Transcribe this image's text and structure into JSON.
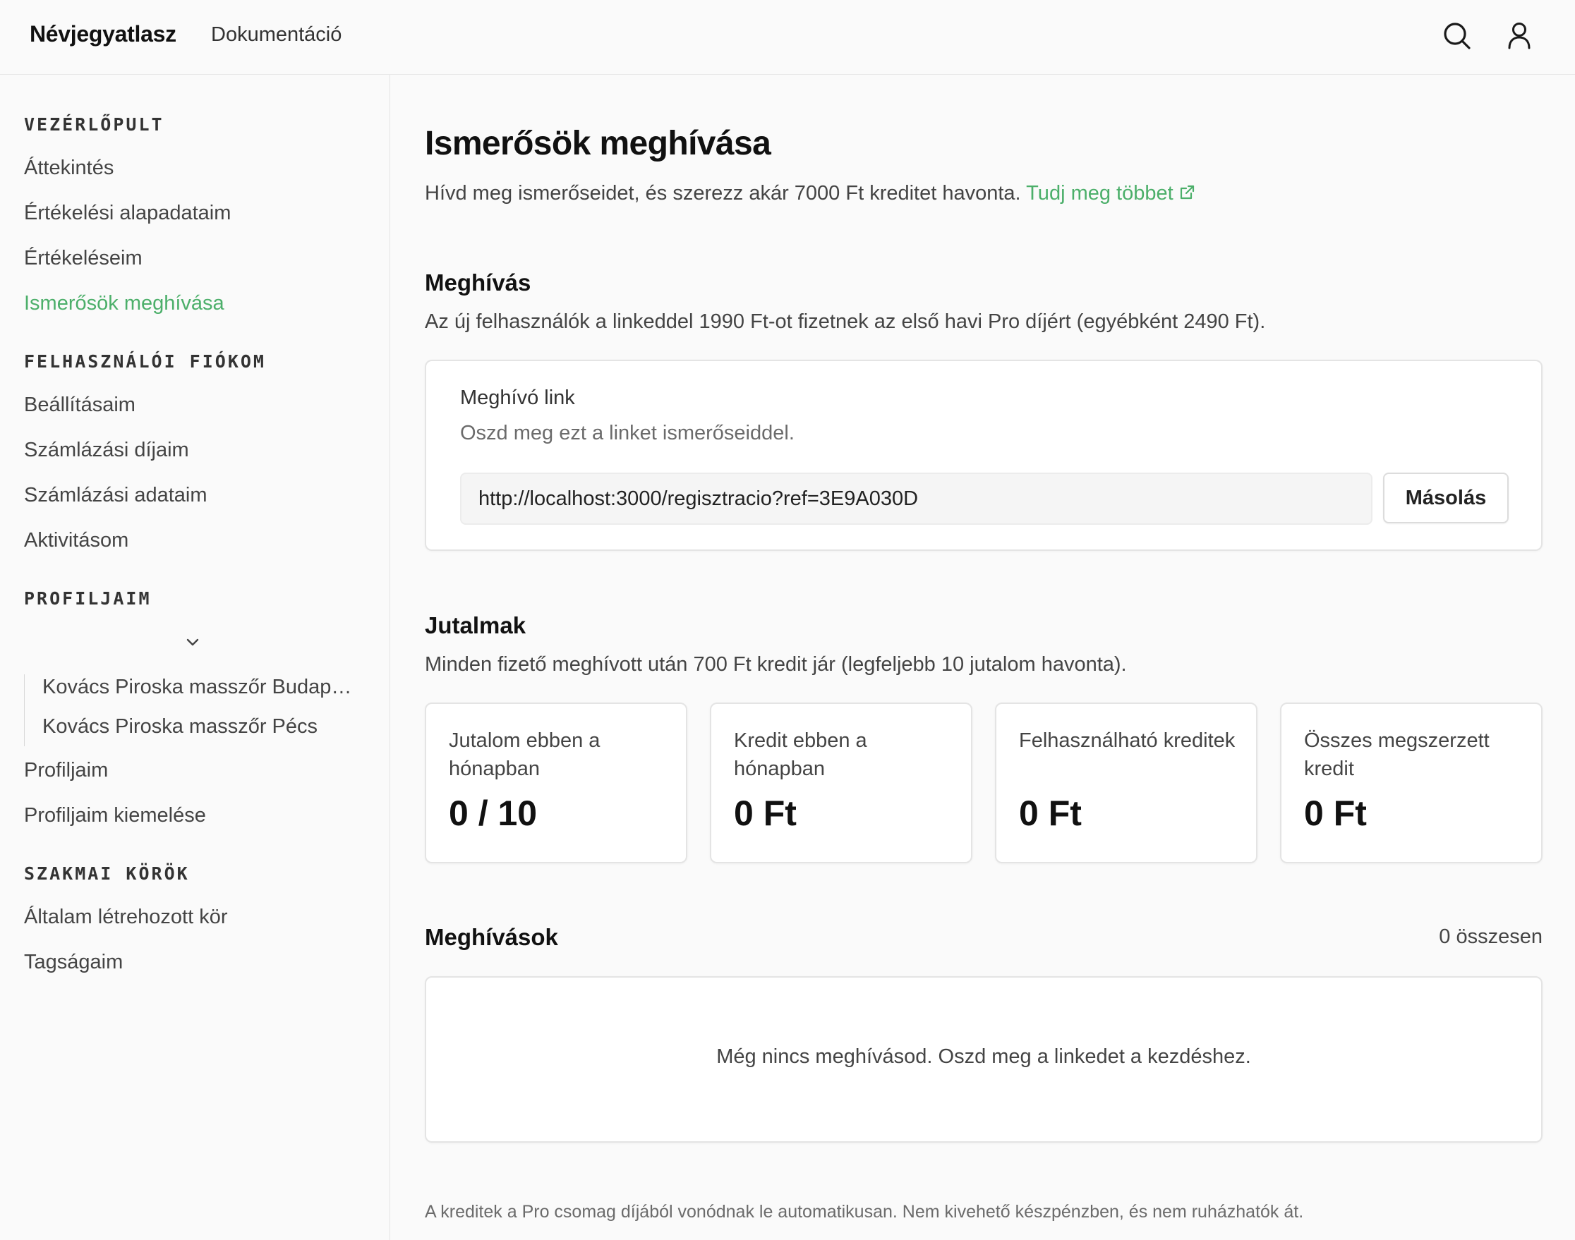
{
  "header": {
    "brand": "Névjegyatlasz",
    "doc_link": "Dokumentáció"
  },
  "sidebar": {
    "sections": [
      {
        "heading": "VEZÉRLŐPULT",
        "items": [
          "Áttekintés",
          "Értékelési alapadataim",
          "Értékeléseim",
          "Ismerősök meghívása"
        ]
      },
      {
        "heading": "FELHASZNÁLÓI FIÓKOM",
        "items": [
          "Beállításaim",
          "Számlázási díjaim",
          "Számlázási adataim",
          "Aktivitásom"
        ]
      },
      {
        "heading": "PROFILJAIM",
        "profiles": [
          "Kovács Piroska masszőr Budapest",
          "Kovács Piroska masszőr Pécs"
        ],
        "items": [
          "Profiljaim",
          "Profiljaim kiemelése"
        ]
      },
      {
        "heading": "SZAKMAI KÖRÖK",
        "items": [
          "Általam létrehozott kör",
          "Tagságaim"
        ]
      }
    ],
    "active_item": "Ismerősök meghívása"
  },
  "main": {
    "title": "Ismerősök meghívása",
    "intro": "Hívd meg ismerőseidet, és szerezz akár 7000 Ft kreditet havonta.",
    "learn_more": "Tudj meg többet",
    "invite_section": {
      "title": "Meghívás",
      "description": "Az új felhasználók a linkeddel 1990 Ft-ot fizetnek az első havi Pro díjért (egyébként 2490 Ft).",
      "card_label": "Meghívó link",
      "card_hint": "Oszd meg ezt a linket ismerőseiddel.",
      "link_value": "http://localhost:3000/regisztracio?ref=3E9A030D",
      "copy_label": "Másolás"
    },
    "rewards_section": {
      "title": "Jutalmak",
      "description": "Minden fizető meghívott után 700 Ft kredit jár (legfeljebb 10 jutalom havonta).",
      "stats": [
        {
          "label": "Jutalom ebben a hónapban",
          "value": "0 / 10"
        },
        {
          "label": "Kredit ebben a hónapban",
          "value": "0 Ft"
        },
        {
          "label": "Felhasználható kreditek",
          "value": "0 Ft"
        },
        {
          "label": "Összes megszerzett kredit",
          "value": "0 Ft"
        }
      ]
    },
    "invites_section": {
      "title": "Meghívások",
      "count": "0 összesen",
      "empty": "Még nincs meghívásod. Oszd meg a linkedet a kezdéshez."
    },
    "footnote": "A kreditek a Pro csomag díjából vonódnak le automatikusan. Nem kivehető készpénzben, és nem ruházhatók át."
  },
  "colors": {
    "accent": "#4caf6a",
    "text": "#1f1f1f",
    "muted": "#6b6b6b",
    "border": "#e4e4e4"
  }
}
